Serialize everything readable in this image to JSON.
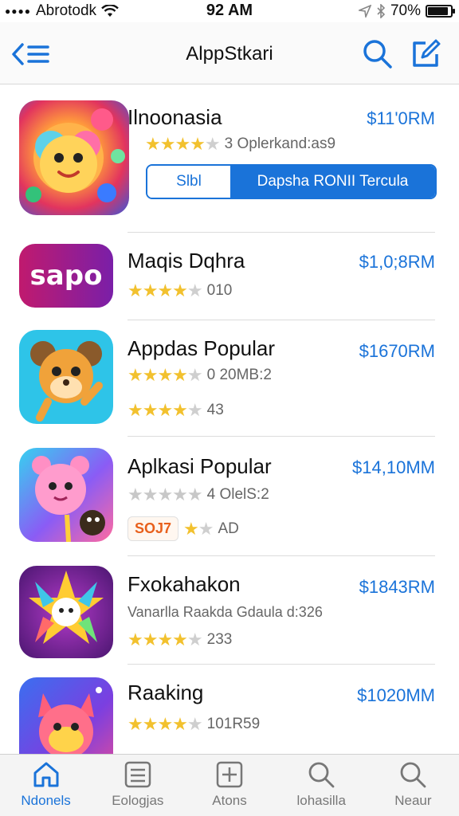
{
  "status_bar": {
    "carrier": "Abrotodk",
    "time": "92 AM",
    "battery": "70%",
    "battery_level": 0.9
  },
  "navbar": {
    "title": "AlppStkari",
    "back_icon": "back-list-icon",
    "search_icon": "search-icon",
    "compose_icon": "compose-icon"
  },
  "apps": [
    {
      "name": "Ilnoonasia",
      "price": "$11'0RM",
      "meta": "3 Oplerkand:as9",
      "segment_left": "Slbl",
      "segment_right": "Dapsha RONII Tercula",
      "icon": "colorful-creature-icon"
    },
    {
      "name": "Maqis Dqhra",
      "price": "$1,0;8RM",
      "meta": "010",
      "icon": "sapo-logo-icon",
      "icon_text": "sapo"
    },
    {
      "name": "Appdas Popular",
      "price": "$1670RM",
      "meta": "0 20MB:2",
      "meta2": "43",
      "icon": "cartoon-animal-icon"
    },
    {
      "name": "Aplkasi Popular",
      "price": "$14,10MM",
      "meta": "4 OlelS:2",
      "badge": "SOJ7",
      "meta2": "AD",
      "icon": "pink-creature-icon"
    },
    {
      "name": "Fxokahakon",
      "price": "$1843RM",
      "meta": "Vanarlla Raakda Gdaula d:326",
      "meta2": "233",
      "icon": "star-badge-icon"
    },
    {
      "name": "Raaking",
      "price": "$1020MM",
      "meta": "101R59",
      "icon": "fox-character-icon"
    }
  ],
  "tabbar": [
    {
      "label": "Ndonels",
      "icon": "home-icon",
      "active": true
    },
    {
      "label": "Eologjas",
      "icon": "list-icon",
      "active": false
    },
    {
      "label": "Atons",
      "icon": "add-icon",
      "active": false
    },
    {
      "label": "lohasilla",
      "icon": "search-icon",
      "active": false
    },
    {
      "label": "Neaur",
      "icon": "search-icon",
      "active": false
    }
  ],
  "colors": {
    "accent": "#1a73d9",
    "star": "#f2c12e",
    "star_off": "#cfcfcf"
  }
}
